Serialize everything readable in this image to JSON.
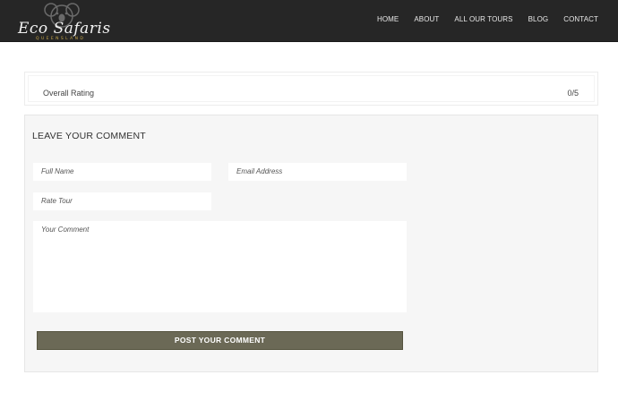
{
  "brand": {
    "name": "Eco Safaris",
    "tagline": "QUEENSLAND",
    "logo_icon": "koala-icon"
  },
  "nav": {
    "items": [
      {
        "label": "HOME"
      },
      {
        "label": "ABOUT"
      },
      {
        "label": "ALL OUR TOURS"
      },
      {
        "label": "BLOG"
      },
      {
        "label": "CONTACT"
      }
    ]
  },
  "rating": {
    "label": "Overall Rating",
    "value": "0/5"
  },
  "comment_form": {
    "title": "LEAVE YOUR COMMENT",
    "full_name_placeholder": "Full Name",
    "email_placeholder": "Email Address",
    "rate_placeholder": "Rate Tour",
    "comment_placeholder": "Your Comment",
    "submit_label": "POST YOUR COMMENT"
  },
  "colors": {
    "header_bg": "#262626",
    "button_bg": "#6b6956",
    "panel_bg": "#f6f6f6",
    "logo_accent": "#c9a84a"
  }
}
